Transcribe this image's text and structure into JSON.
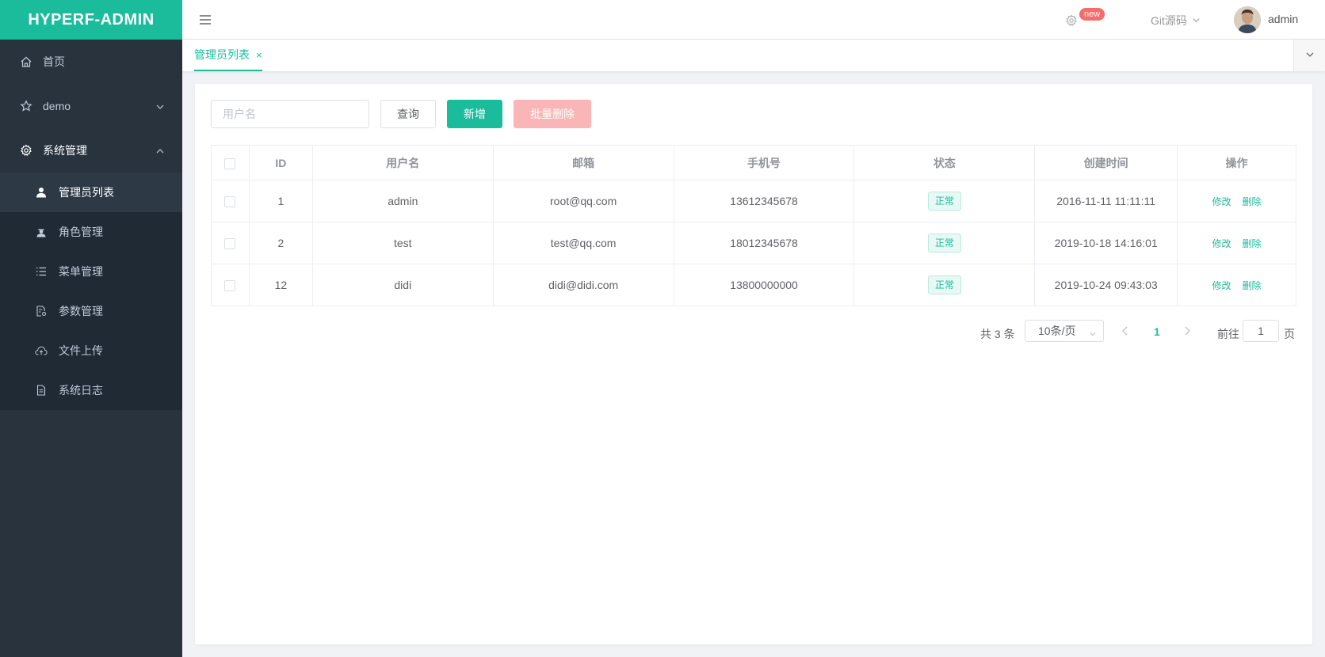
{
  "app": {
    "logo": "HYPERF-ADMIN"
  },
  "sidebar": {
    "items": [
      {
        "label": "首页",
        "icon": "home-icon"
      },
      {
        "label": "demo",
        "icon": "star-icon"
      },
      {
        "label": "系统管理",
        "icon": "gear-icon"
      }
    ],
    "submenu": [
      {
        "label": "管理员列表",
        "icon": "user-icon",
        "active": true
      },
      {
        "label": "角色管理",
        "icon": "role-icon"
      },
      {
        "label": "菜单管理",
        "icon": "list-icon"
      },
      {
        "label": "参数管理",
        "icon": "params-icon"
      },
      {
        "label": "文件上传",
        "icon": "upload-icon"
      },
      {
        "label": "系统日志",
        "icon": "log-icon"
      }
    ]
  },
  "header": {
    "new_badge": "new",
    "git_source": "Git源码",
    "user_name": "admin"
  },
  "tabs": [
    {
      "label": "管理员列表",
      "close": "×"
    }
  ],
  "toolbar": {
    "search_placeholder": "用户名",
    "query_label": "查询",
    "add_label": "新增",
    "batch_delete_label": "批量删除"
  },
  "table": {
    "columns": [
      "ID",
      "用户名",
      "邮箱",
      "手机号",
      "状态",
      "创建时间",
      "操作"
    ],
    "rows": [
      {
        "id": "1",
        "username": "admin",
        "email": "root@qq.com",
        "phone": "13612345678",
        "status": "正常",
        "created": "2016-11-11 11:11:11",
        "edit": "修改",
        "delete": "删除"
      },
      {
        "id": "2",
        "username": "test",
        "email": "test@qq.com",
        "phone": "18012345678",
        "status": "正常",
        "created": "2019-10-18 14:16:01",
        "edit": "修改",
        "delete": "删除"
      },
      {
        "id": "12",
        "username": "didi",
        "email": "didi@didi.com",
        "phone": "13800000000",
        "status": "正常",
        "created": "2019-10-24 09:43:03",
        "edit": "修改",
        "delete": "删除"
      }
    ]
  },
  "pagination": {
    "total_text": "共 3 条",
    "page_size": "10条/页",
    "current_page": "1",
    "goto_label": "前往",
    "goto_value": "1",
    "page_suffix": "页"
  },
  "colors": {
    "accent": "#1abc9c",
    "sidebar_bg": "#28333e",
    "danger_light": "#fab6b6",
    "badge": "#f56c6c"
  }
}
